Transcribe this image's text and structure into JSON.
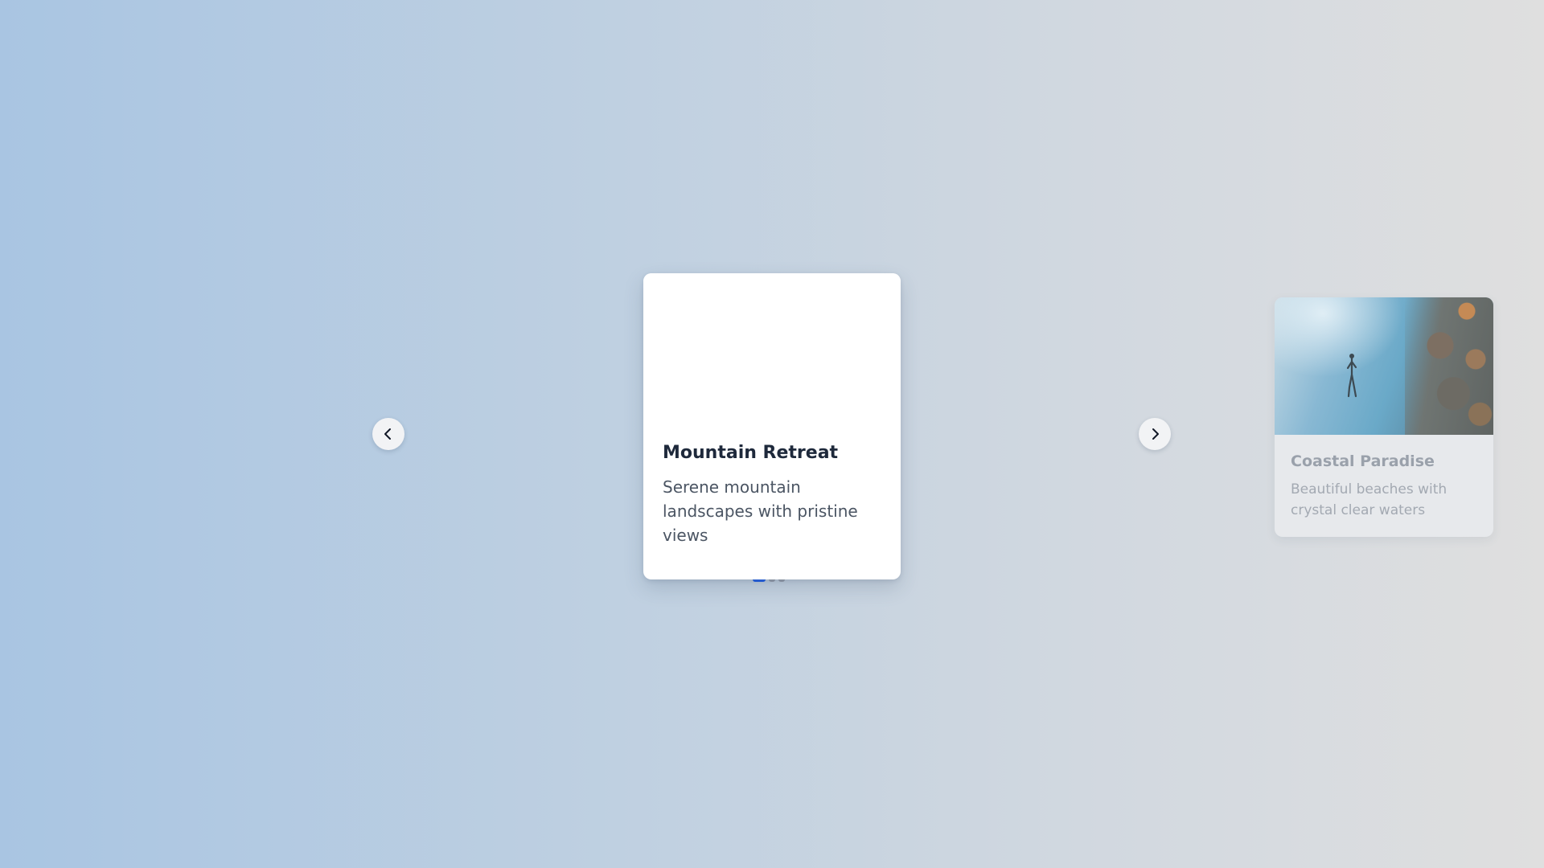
{
  "carousel": {
    "active_card": {
      "title": "Mountain Retreat",
      "description": "Serene mountain landscapes with pristine views"
    },
    "next_card": {
      "title": "Coastal Paradise",
      "description": "Beautiful beaches with crystal clear waters"
    },
    "controls": {
      "prev_icon": "chevron-left-icon",
      "next_icon": "chevron-right-icon"
    },
    "pagination": {
      "total": 3,
      "active_index": 0,
      "active_color": "#2563eb",
      "inactive_color": "#9ca3af"
    }
  }
}
